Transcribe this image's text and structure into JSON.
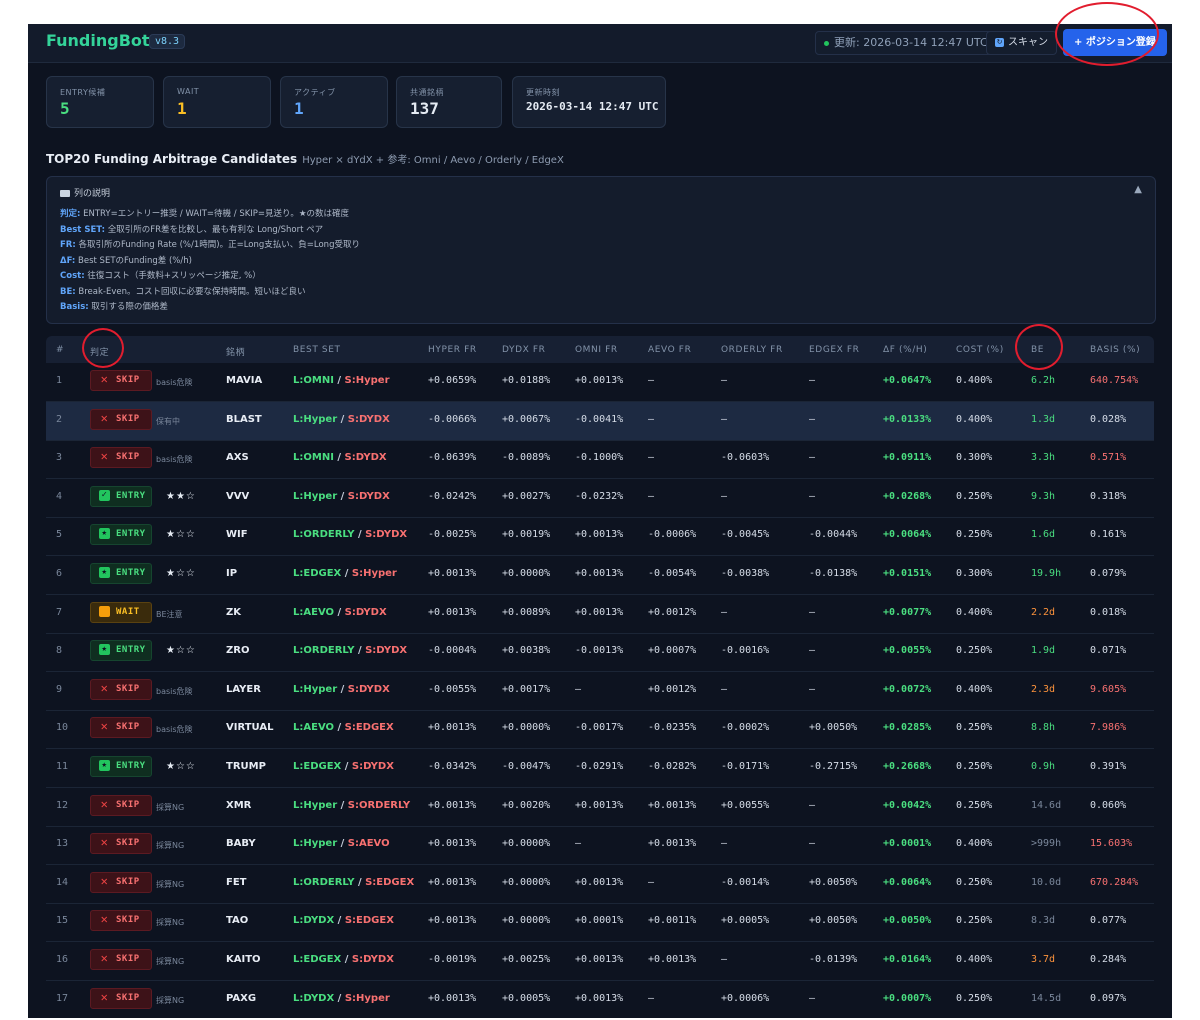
{
  "header": {
    "logo": "FundingBot",
    "version": "v8.3",
    "updated": "更新: 2026-03-14 12:47 UTC",
    "scan_label": "スキャン",
    "add_position_label": "+ ポジション登録"
  },
  "stats": [
    {
      "label": "ENTRY候補",
      "value": "5",
      "color": "#4ade80"
    },
    {
      "label": "WAIT",
      "value": "1",
      "color": "#fbbf24"
    },
    {
      "label": "アクティブ",
      "value": "1",
      "color": "#60a5fa"
    },
    {
      "label": "共通銘柄",
      "value": "137",
      "color": "#e5ebf3"
    },
    {
      "label": "更新時刻",
      "value": "2026-03-14 12:47 UTC",
      "color": "#e5ebf3"
    }
  ],
  "section": {
    "title": "TOP20 Funding Arbitrage Candidates",
    "subtitle": "Hyper × dYdX + 参考: Omni / Aevo / Orderly / EdgeX"
  },
  "legend": {
    "heading": "列の説明",
    "toggle": "▲",
    "lines": [
      {
        "key": "判定:",
        "text": "ENTRY=エントリー推奨 / WAIT=待機 / SKIP=見送り。★の数は確度"
      },
      {
        "key": "Best SET:",
        "text": "全取引所のFR差を比較し、最も有利な Long/Short ペア"
      },
      {
        "key": "FR:",
        "text": "各取引所のFunding Rate (%/1時間)。正=Long支払い、負=Long受取り"
      },
      {
        "key": "ΔF:",
        "text": "Best SETのFunding差 (%/h)"
      },
      {
        "key": "Cost:",
        "text": "往復コスト（手数料+スリッページ推定, %）"
      },
      {
        "key": "BE:",
        "text": "Break-Even。コスト回収に必要な保持時間。短いほど良い"
      },
      {
        "key": "Basis:",
        "text": "取引する際の価格差"
      }
    ]
  },
  "table": {
    "headers": [
      "#",
      "判定",
      "銘柄",
      "BEST SET",
      "HYPER FR",
      "DYDX FR",
      "OMNI FR",
      "AEVO FR",
      "ORDERLY FR",
      "EDGEX FR",
      "ΔF (%/H)",
      "COST (%)",
      "BE",
      "BASIS (%)"
    ],
    "rows": [
      {
        "n": "1",
        "verdict": "SKIP",
        "note": "basis危険",
        "stars": "",
        "sym": "MAVIA",
        "long": "L:OMNI",
        "short": "S:Hyper",
        "hyper": "+0.0659%",
        "dydx": "+0.0188%",
        "omni": "+0.0013%",
        "aevo": "—",
        "orderly": "—",
        "edgex": "—",
        "df": "+0.0647%",
        "cost": "0.400%",
        "be": "6.2h",
        "be_c": "green",
        "basis": "640.754%",
        "basis_c": "red"
      },
      {
        "n": "2",
        "verdict": "SKIP",
        "note": "保有中",
        "stars": "",
        "sym": "BLAST",
        "long": "L:Hyper",
        "short": "S:DYDX",
        "hyper": "-0.0066%",
        "dydx": "+0.0067%",
        "omni": "-0.0041%",
        "aevo": "—",
        "orderly": "—",
        "edgex": "—",
        "df": "+0.0133%",
        "cost": "0.400%",
        "be": "1.3d",
        "be_c": "green",
        "basis": "0.028%",
        "basis_c": "norm",
        "hl": true
      },
      {
        "n": "3",
        "verdict": "SKIP",
        "note": "basis危険",
        "stars": "",
        "sym": "AXS",
        "long": "L:OMNI",
        "short": "S:DYDX",
        "hyper": "-0.0639%",
        "dydx": "-0.0089%",
        "omni": "-0.1000%",
        "aevo": "—",
        "orderly": "-0.0603%",
        "edgex": "—",
        "df": "+0.0911%",
        "cost": "0.300%",
        "be": "3.3h",
        "be_c": "green",
        "basis": "0.571%",
        "basis_c": "red"
      },
      {
        "n": "4",
        "verdict": "ENTRY",
        "note": "",
        "stars": "★★☆",
        "sym": "VVV",
        "long": "L:Hyper",
        "short": "S:DYDX",
        "hyper": "-0.0242%",
        "dydx": "+0.0027%",
        "omni": "-0.0232%",
        "aevo": "—",
        "orderly": "—",
        "edgex": "—",
        "df": "+0.0268%",
        "cost": "0.250%",
        "be": "9.3h",
        "be_c": "green",
        "basis": "0.318%",
        "basis_c": "norm",
        "icon": "check"
      },
      {
        "n": "5",
        "verdict": "ENTRY",
        "note": "",
        "stars": "★☆☆",
        "sym": "WIF",
        "long": "L:ORDERLY",
        "short": "S:DYDX",
        "hyper": "-0.0025%",
        "dydx": "+0.0019%",
        "omni": "+0.0013%",
        "aevo": "-0.0006%",
        "orderly": "-0.0045%",
        "edgex": "-0.0044%",
        "df": "+0.0064%",
        "cost": "0.250%",
        "be": "1.6d",
        "be_c": "green",
        "basis": "0.161%",
        "basis_c": "norm",
        "icon": "star"
      },
      {
        "n": "6",
        "verdict": "ENTRY",
        "note": "",
        "stars": "★☆☆",
        "sym": "IP",
        "long": "L:EDGEX",
        "short": "S:Hyper",
        "hyper": "+0.0013%",
        "dydx": "+0.0000%",
        "omni": "+0.0013%",
        "aevo": "-0.0054%",
        "orderly": "-0.0038%",
        "edgex": "-0.0138%",
        "df": "+0.0151%",
        "cost": "0.300%",
        "be": "19.9h",
        "be_c": "green",
        "basis": "0.079%",
        "basis_c": "norm",
        "icon": "star"
      },
      {
        "n": "7",
        "verdict": "WAIT",
        "note": "BE注意",
        "stars": "",
        "sym": "ZK",
        "long": "L:AEVO",
        "short": "S:DYDX",
        "hyper": "+0.0013%",
        "dydx": "+0.0089%",
        "omni": "+0.0013%",
        "aevo": "+0.0012%",
        "orderly": "—",
        "edgex": "—",
        "df": "+0.0077%",
        "cost": "0.400%",
        "be": "2.2d",
        "be_c": "orange",
        "basis": "0.018%",
        "basis_c": "norm"
      },
      {
        "n": "8",
        "verdict": "ENTRY",
        "note": "",
        "stars": "★☆☆",
        "sym": "ZRO",
        "long": "L:ORDERLY",
        "short": "S:DYDX",
        "hyper": "-0.0004%",
        "dydx": "+0.0038%",
        "omni": "-0.0013%",
        "aevo": "+0.0007%",
        "orderly": "-0.0016%",
        "edgex": "—",
        "df": "+0.0055%",
        "cost": "0.250%",
        "be": "1.9d",
        "be_c": "green",
        "basis": "0.071%",
        "basis_c": "norm",
        "icon": "star"
      },
      {
        "n": "9",
        "verdict": "SKIP",
        "note": "basis危険",
        "stars": "",
        "sym": "LAYER",
        "long": "L:Hyper",
        "short": "S:DYDX",
        "hyper": "-0.0055%",
        "dydx": "+0.0017%",
        "omni": "—",
        "aevo": "+0.0012%",
        "orderly": "—",
        "edgex": "—",
        "df": "+0.0072%",
        "cost": "0.400%",
        "be": "2.3d",
        "be_c": "orange",
        "basis": "9.605%",
        "basis_c": "red"
      },
      {
        "n": "10",
        "verdict": "SKIP",
        "note": "basis危険",
        "stars": "",
        "sym": "VIRTUAL",
        "long": "L:AEVO",
        "short": "S:EDGEX",
        "hyper": "+0.0013%",
        "dydx": "+0.0000%",
        "omni": "-0.0017%",
        "aevo": "-0.0235%",
        "orderly": "-0.0002%",
        "edgex": "+0.0050%",
        "df": "+0.0285%",
        "cost": "0.250%",
        "be": "8.8h",
        "be_c": "green",
        "basis": "7.986%",
        "basis_c": "red"
      },
      {
        "n": "11",
        "verdict": "ENTRY",
        "note": "",
        "stars": "★☆☆",
        "sym": "TRUMP",
        "long": "L:EDGEX",
        "short": "S:DYDX",
        "hyper": "-0.0342%",
        "dydx": "-0.0047%",
        "omni": "-0.0291%",
        "aevo": "-0.0282%",
        "orderly": "-0.0171%",
        "edgex": "-0.2715%",
        "df": "+0.2668%",
        "cost": "0.250%",
        "be": "0.9h",
        "be_c": "green",
        "basis": "0.391%",
        "basis_c": "norm",
        "icon": "star"
      },
      {
        "n": "12",
        "verdict": "SKIP",
        "note": "採算NG",
        "stars": "",
        "sym": "XMR",
        "long": "L:Hyper",
        "short": "S:ORDERLY",
        "hyper": "+0.0013%",
        "dydx": "+0.0020%",
        "omni": "+0.0013%",
        "aevo": "+0.0013%",
        "orderly": "+0.0055%",
        "edgex": "—",
        "df": "+0.0042%",
        "cost": "0.250%",
        "be": "14.6d",
        "be_c": "gray",
        "basis": "0.060%",
        "basis_c": "norm"
      },
      {
        "n": "13",
        "verdict": "SKIP",
        "note": "採算NG",
        "stars": "",
        "sym": "BABY",
        "long": "L:Hyper",
        "short": "S:AEVO",
        "hyper": "+0.0013%",
        "dydx": "+0.0000%",
        "omni": "—",
        "aevo": "+0.0013%",
        "orderly": "—",
        "edgex": "—",
        "df": "+0.0001%",
        "cost": "0.400%",
        "be": ">999h",
        "be_c": "gray",
        "basis": "15.603%",
        "basis_c": "red"
      },
      {
        "n": "14",
        "verdict": "SKIP",
        "note": "採算NG",
        "stars": "",
        "sym": "FET",
        "long": "L:ORDERLY",
        "short": "S:EDGEX",
        "hyper": "+0.0013%",
        "dydx": "+0.0000%",
        "omni": "+0.0013%",
        "aevo": "—",
        "orderly": "-0.0014%",
        "edgex": "+0.0050%",
        "df": "+0.0064%",
        "cost": "0.250%",
        "be": "10.0d",
        "be_c": "gray",
        "basis": "670.284%",
        "basis_c": "red"
      },
      {
        "n": "15",
        "verdict": "SKIP",
        "note": "採算NG",
        "stars": "",
        "sym": "TAO",
        "long": "L:DYDX",
        "short": "S:EDGEX",
        "hyper": "+0.0013%",
        "dydx": "+0.0000%",
        "omni": "+0.0001%",
        "aevo": "+0.0011%",
        "orderly": "+0.0005%",
        "edgex": "+0.0050%",
        "df": "+0.0050%",
        "cost": "0.250%",
        "be": "8.3d",
        "be_c": "gray",
        "basis": "0.077%",
        "basis_c": "norm"
      },
      {
        "n": "16",
        "verdict": "SKIP",
        "note": "採算NG",
        "stars": "",
        "sym": "KAITO",
        "long": "L:EDGEX",
        "short": "S:DYDX",
        "hyper": "-0.0019%",
        "dydx": "+0.0025%",
        "omni": "+0.0013%",
        "aevo": "+0.0013%",
        "orderly": "—",
        "edgex": "-0.0139%",
        "df": "+0.0164%",
        "cost": "0.400%",
        "be": "3.7d",
        "be_c": "orange",
        "basis": "0.284%",
        "basis_c": "norm"
      },
      {
        "n": "17",
        "verdict": "SKIP",
        "note": "採算NG",
        "stars": "",
        "sym": "PAXG",
        "long": "L:DYDX",
        "short": "S:Hyper",
        "hyper": "+0.0013%",
        "dydx": "+0.0005%",
        "omni": "+0.0013%",
        "aevo": "—",
        "orderly": "+0.0006%",
        "edgex": "—",
        "df": "+0.0007%",
        "cost": "0.250%",
        "be": "14.5d",
        "be_c": "gray",
        "basis": "0.097%",
        "basis_c": "norm"
      }
    ]
  }
}
